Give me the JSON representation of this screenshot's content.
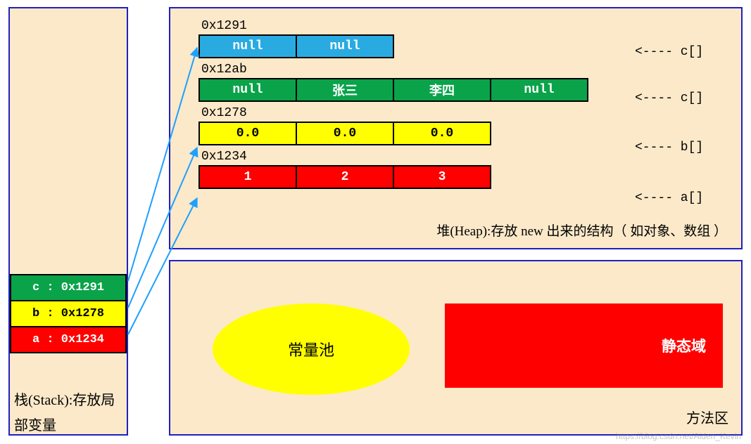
{
  "stack": {
    "vars": [
      {
        "name": "c",
        "addr": "0x1291",
        "color": "green"
      },
      {
        "name": "b",
        "addr": "0x1278",
        "color": "yellow"
      },
      {
        "name": "a",
        "addr": "0x1234",
        "color": "red"
      }
    ],
    "caption": "栈(Stack):存放局部变量"
  },
  "heap": {
    "arrays": [
      {
        "addr": "0x1291",
        "color": "blue",
        "cells": [
          "null",
          "null"
        ],
        "label": "<---- c[]"
      },
      {
        "addr": "0x12ab",
        "color": "green",
        "cells": [
          "null",
          "张三",
          "李四",
          "null"
        ],
        "label": "<---- c[]"
      },
      {
        "addr": "0x1278",
        "color": "yellow",
        "cells": [
          "0.0",
          "0.0",
          "0.0"
        ],
        "label": "<---- b[]"
      },
      {
        "addr": "0x1234",
        "color": "red",
        "cells": [
          "1",
          "2",
          "3"
        ],
        "label": "<---- a[]"
      }
    ],
    "caption": "堆(Heap):存放 new 出来的结构（ 如对象、数组 ）"
  },
  "methodArea": {
    "constPool": "常量池",
    "staticArea": "静态域",
    "caption": "方法区"
  },
  "watermark": "https://blog.csdn.net/Aiden_Kevin"
}
